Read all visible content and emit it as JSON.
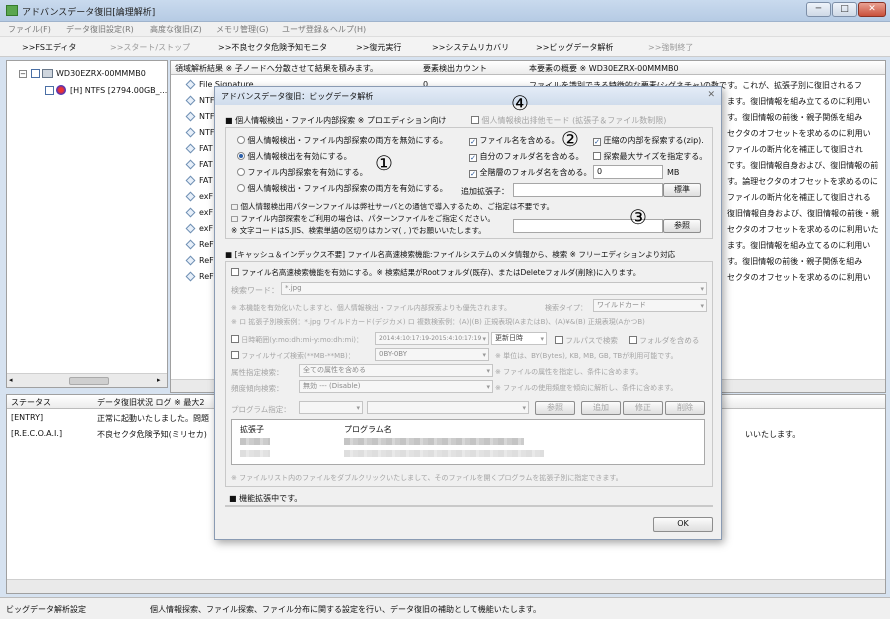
{
  "window": {
    "title": "アドバンスデータ復旧[論理解析]",
    "buttons": [
      "─",
      "□",
      "✕"
    ]
  },
  "menu": [
    "ファイル(F)",
    "データ復旧設定(R)",
    "高度な復旧(Z)",
    "メモリ管理(G)",
    "ユーザ登録＆ヘルプ(H)"
  ],
  "toolbar": [
    ">>FSエディタ",
    ">>スタート/ストップ",
    ">>不良セクタ危険予知モニタ",
    ">>復元実行",
    ">>システムリカバリ",
    ">>ビッグデータ解析",
    ">>強制終了"
  ],
  "tree": {
    "drive": "WD30EZRX-00MMMB0",
    "partition": "[H] NTFS [2794.00GB_..."
  },
  "table": {
    "headers": [
      "領域解析結果 ※ 子ノードへ分散させて結果を積みます。",
      "要素検出カウント",
      "本要素の概要 ※ WD30EZRX-00MMMB0"
    ],
    "rows": [
      {
        "name": "File Signature",
        "count": "0",
        "desc": "ファイルを識別できる特徴的な要素(シグネチャ)の数です。これが、拡張子別に復旧されるフ"
      },
      {
        "name": "NTF",
        "count": "",
        "desc": "ます。復旧情報を組み立てるのに利用い"
      },
      {
        "name": "NTF",
        "count": "",
        "desc": "す。復旧情報の前後・親子関係を組み"
      },
      {
        "name": "NTF",
        "count": "",
        "desc": "セクタのオフセットを求めるのに利用い"
      },
      {
        "name": "FAT",
        "count": "",
        "desc": "ファイルの断片化を補正して復旧され"
      },
      {
        "name": "FAT",
        "count": "",
        "desc": "です。復旧情報自身および、復旧情報の前"
      },
      {
        "name": "FAT",
        "count": "",
        "desc": "す。論理セクタのオフセットを求めるのに"
      },
      {
        "name": "exF",
        "count": "",
        "desc": "ファイルの断片化を補正して復旧される"
      },
      {
        "name": "exF",
        "count": "",
        "desc": "復旧情報自身および、復旧情報の前後・親"
      },
      {
        "name": "exF",
        "count": "",
        "desc": "セクタのオフセットを求めるのに利用いた"
      },
      {
        "name": "ReF",
        "count": "",
        "desc": "ます。復旧情報を組み立てるのに利用い"
      },
      {
        "name": "ReF",
        "count": "",
        "desc": "す。復旧情報の前後・親子関係を組み"
      },
      {
        "name": "ReF",
        "count": "",
        "desc": "セクタのオフセットを求めるのに利用い"
      }
    ]
  },
  "log": {
    "headers": [
      "ステータス",
      "データ復旧状況 ログ ※ 最大2"
    ],
    "rows": [
      {
        "status": "[ENTRY]",
        "msg": "正常に起動いたしました。問題"
      },
      {
        "status": "[R.E.C.O.A.I.]",
        "msg": "不良セクタ危険予知(ミリセカ)",
        "tail": "いいたします。"
      }
    ]
  },
  "statusbar": {
    "left": "ビッグデータ解析設定",
    "right": "個人情報探索、ファイル探索、ファイル分布に関する設定を行い、データ復旧の補助として機能いたします。"
  },
  "dialog": {
    "title": "アドバンスデータ復旧：ビッグデータ解析",
    "close": "✕",
    "sec1_title": "■ 個人情報検出・ファイル内部探索 ※ プロエディション向け",
    "exclusive_mode": "個人情報検出排他モード (拡張子＆ファイル数制限)",
    "radios": [
      "個人情報検出・ファイル内部探索の両方を無効にする。",
      "個人情報検出を有効にする。",
      "ファイル内部探索を有効にする。",
      "個人情報検出・ファイル内部探索の両方を有効にする。"
    ],
    "checks": {
      "include_filename": "ファイル名を含める。",
      "include_own_folder": "自分のフォルダ名を含める。",
      "include_all_folders": "全階層のフォルダ名を含める。",
      "search_zip": "圧縮の内部を探索する(zip).",
      "max_size": "探索最大サイズを指定する。"
    },
    "size_value": "0",
    "size_unit": "MB",
    "ext_label": "追加拡張子：",
    "standard_btn": "標準",
    "note1": "□ 個人情報検出用パターンファイルは弊社サーバとの通信で導入するため、ご指定は不要です。",
    "note2": "□ ファイル内部探索をご利用の場合は、パターンファイルをご指定ください。",
    "note3": "※ 文字コードはS.JIS、検索単語の区切りはカンマ( , )でお願いいたします。",
    "browse_btn": "参照",
    "sec2_title": "■ [キャッシュ＆インデックス不要] ファイル名高速検索機能:ファイルシステムのメタ情報から、検索 ※ フリーエディションより対応",
    "fast_search": "ファイル名高速検索機能を有効にする。※ 検索結果がRootフォルダ(既存)、またはDeleteフォルダ(削除)に入ります。",
    "keyword_label": "検索ワード：",
    "keyword_value": "*.jpg",
    "priority_note": "※ 本機能を有効化いたしますと、個人情報検出・ファイル内部探索よりも優先されます。",
    "search_type_label": "検索タイプ：",
    "search_type_value": "ワイルドカード",
    "ext_note": "※ ロ 拡張子別検索例：*.jpg ワイルドカード(デジカメ) ロ 複数検索例：(A)|(B) 正規表現(AまたはB)、(A)¥&(B) 正規表現(AかつB)",
    "date_label": "日時範囲(y:mo:dh:mi-y:mo:dh:mi)：",
    "date_value": "2014:4:10:17:19-2015:4:10:17:19",
    "date_mode": "更新日時",
    "fullpath": "フルパスで検索",
    "include_folder": "フォルダを含める",
    "size_label": "ファイルサイズ検索(**MB-**MB)：",
    "size_range": "0BY-0BY",
    "size_note": "※ 単位は、BY(Bytes), KB, MB, GB, TBが利用可能です。",
    "attr_label": "属性指定検索：",
    "attr_value": "全ての属性を含める",
    "attr_note": "※ ファイルの属性を指定し、条件に含めます。",
    "freq_label": "頻度傾向検索：",
    "freq_value": "無効 --- (Disable)",
    "freq_note": "※ ファイルの使用頻度を傾向に解析し、条件に含めます。",
    "program_label": "プログラム指定：",
    "prog_buttons": [
      "参照",
      "追加",
      "修正",
      "削除"
    ],
    "list_headers": [
      "拡張子",
      "プログラム名"
    ],
    "list_note": "※ ファイルリスト内のファイルをダブルクリックいたしまして、そのファイルを開くプログラムを拡張子別に指定できます。",
    "sec3_title": "■ 機能拡張中です。",
    "ok": "OK"
  },
  "annotations": [
    "④",
    "②",
    "①",
    "③"
  ]
}
